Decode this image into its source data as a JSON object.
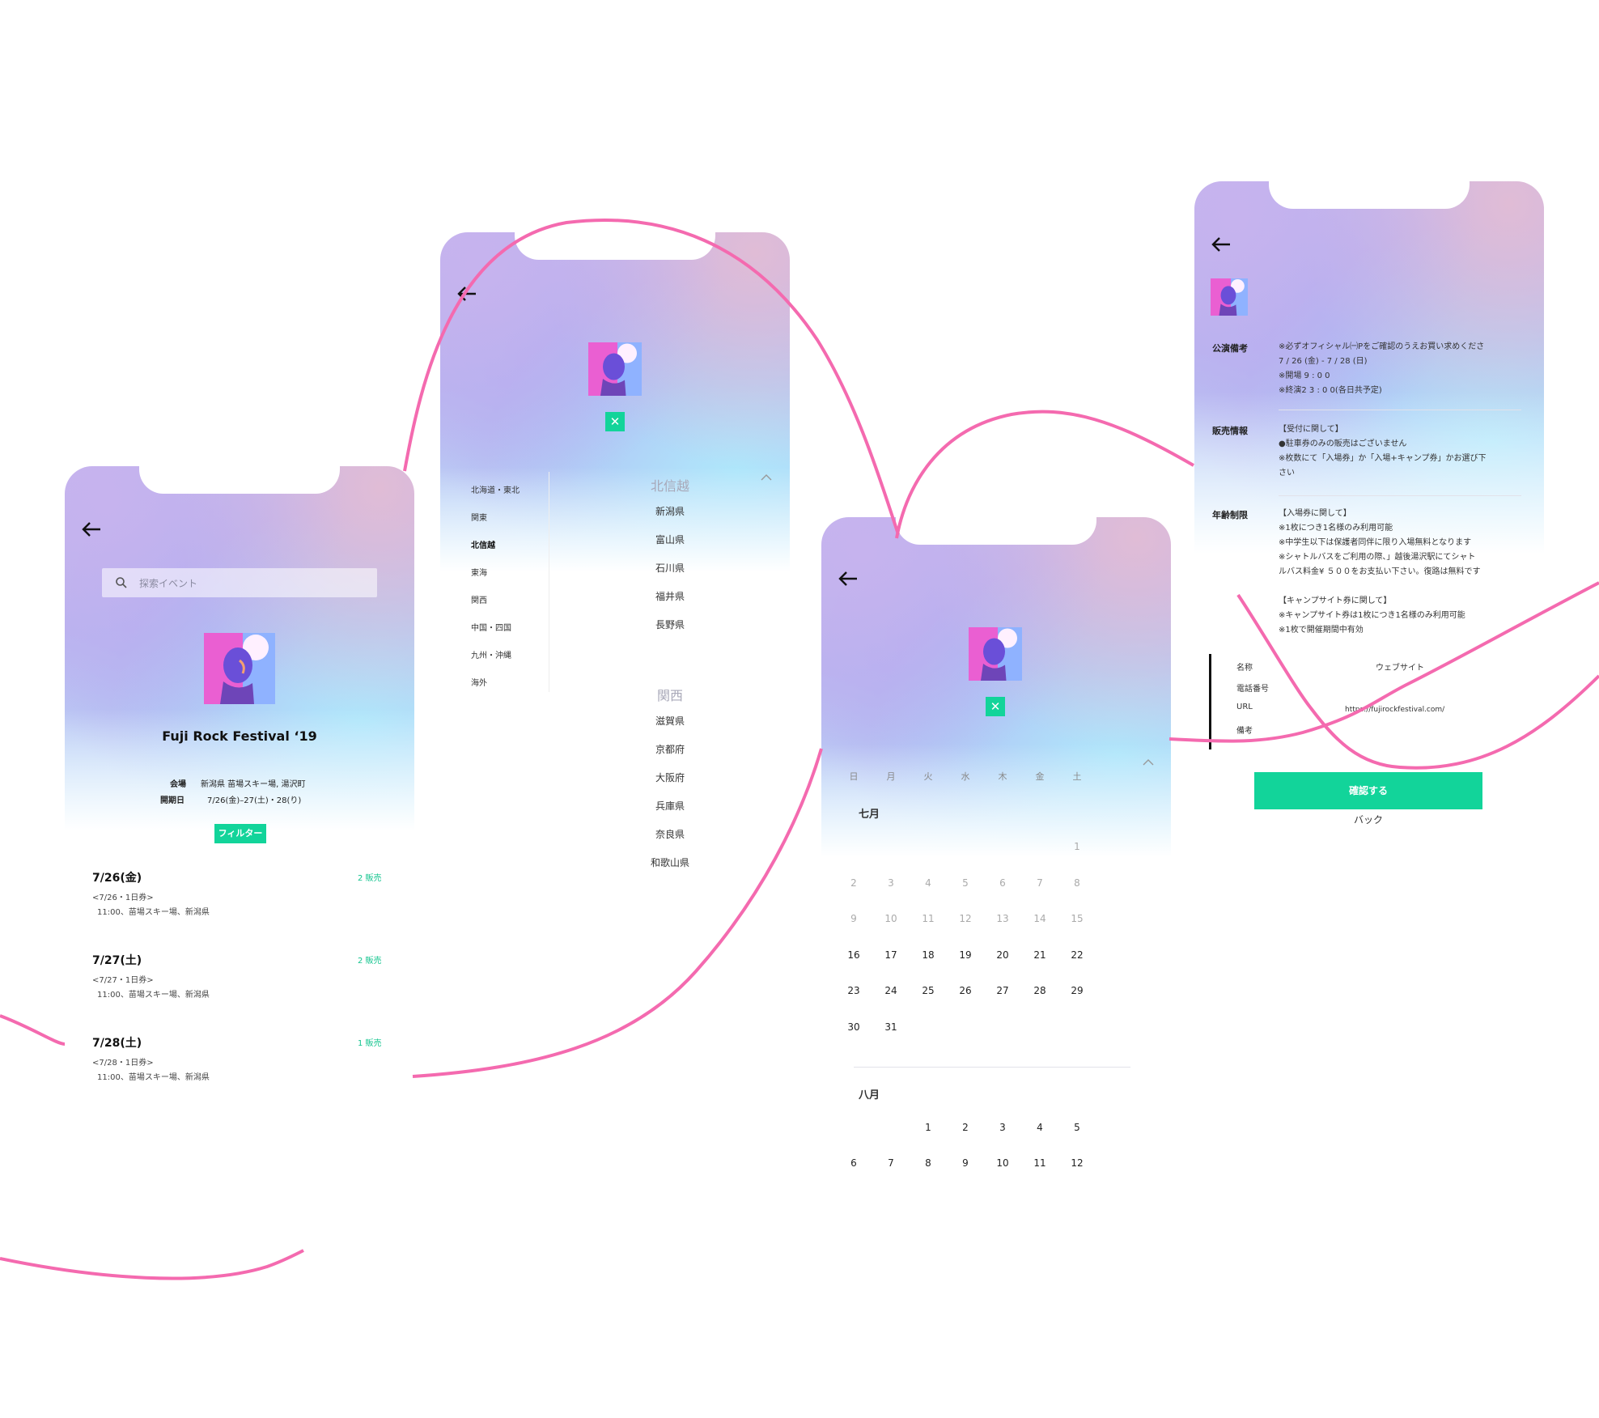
{
  "colors": {
    "accent": "#12d49a",
    "curve": "#f46aaf"
  },
  "icons": {
    "back": "arrow-left-icon",
    "search": "search-icon",
    "close": "close-icon",
    "collapse": "chevron-up-icon"
  },
  "event_list": {
    "search_placeholder": "探索イベント",
    "title": "Fuji Rock Festival ‘19",
    "venue_label": "会場",
    "venue_value": "新潟県 苗場スキー場, 湯沢町",
    "date_label": "開期日",
    "date_value": "7/26(金)–27(土)・28(り)",
    "filter_label": "フィルター",
    "events": [
      {
        "date": "7/26(金)",
        "ticket": "<7/26・1日券>",
        "detail": "11:00、苗場スキー場、新潟県",
        "badge": "2 販売"
      },
      {
        "date": "7/27(土)",
        "ticket": "<7/27・1日券>",
        "detail": "11:00、苗場スキー場、新潟県",
        "badge": "2 販売"
      },
      {
        "date": "7/28(土)",
        "ticket": "<7/28・1日券>",
        "detail": "11:00、苗場スキー場、新潟県",
        "badge": "1 販売"
      }
    ]
  },
  "region_filter": {
    "regions": [
      "北海道・東北",
      "関東",
      "北信越",
      "東海",
      "関西",
      "中国・四国",
      "九州・沖縄",
      "海外"
    ],
    "active_region": "北信越",
    "groups": [
      {
        "heading": "北信越",
        "prefs": [
          "新潟県",
          "富山県",
          "石川県",
          "福井県",
          "長野県"
        ]
      },
      {
        "heading": "関西",
        "prefs": [
          "滋賀県",
          "京都府",
          "大阪府",
          "兵庫県",
          "奈良県",
          "和歌山県"
        ]
      }
    ]
  },
  "calendar": {
    "weekdays": [
      "日",
      "月",
      "火",
      "水",
      "木",
      "金",
      "土"
    ],
    "months": [
      {
        "name": "七月",
        "first_weekday": 6,
        "days": 31,
        "dim_until": 16
      },
      {
        "name": "八月",
        "first_weekday": 2,
        "days": 12,
        "dim_until": 0
      }
    ]
  },
  "detail": {
    "sections": [
      {
        "label": "公演備考",
        "text": "※必ずオフィシャル㈠Pをご確認のうえお買い求めくださ\n7 / 26 (金) - 7 / 28 (日)\n※開場 9 : 0 0\n※終演2 3 : 0 0(各日共予定)"
      },
      {
        "label": "販売情報",
        "text": "【受付に関して】\n●駐車券のみの販売はございません\n※枚数にて「入場券」か「入場+キャンプ券」かお選び下\nさい"
      },
      {
        "label": "年齢制限",
        "text": "【入場券に関して】\n※1枚につき1名様のみ利用可能\n※中学生以下は保護者同伴に限り入場無料となります\n※シャトルバスをご利用の際、」越後湯沢駅にてシャト\nルバス料金¥ ５００をお支払い下さい。復路は無料です\n\n【キャンプサイト券に関して】\n※キャンプサイト券は1枚につき1名様のみ利用可能\n※1枚で開催期間中有効"
      }
    ],
    "info_labels": [
      "名称",
      "電話番号",
      "URL",
      "備考"
    ],
    "info_name": "ウェブサイト",
    "info_url": "https://fujirockfestival.com/",
    "confirm_label": "確認する",
    "back_label": "バック"
  }
}
